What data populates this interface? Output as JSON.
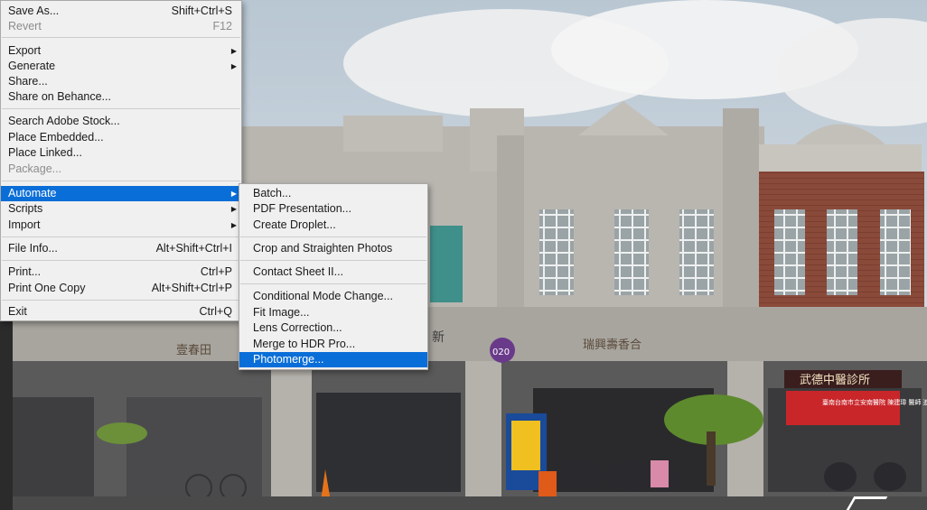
{
  "background": {
    "sign_1": "壹春田",
    "sign_2": "瑞興壽香合",
    "sign_3": "武德中醫診所",
    "banner": "臺南台南市立安南醫院 陳建瑋 醫師 進入轉診",
    "sign_4": "新",
    "sign_5": "020"
  },
  "file_menu": {
    "items": [
      {
        "label": "Save As...",
        "shortcut": "Shift+Ctrl+S"
      },
      {
        "label": "Revert",
        "shortcut": "F12"
      },
      {
        "label": "Export"
      },
      {
        "label": "Generate"
      },
      {
        "label": "Share..."
      },
      {
        "label": "Share on Behance..."
      },
      {
        "label": "Search Adobe Stock..."
      },
      {
        "label": "Place Embedded..."
      },
      {
        "label": "Place Linked..."
      },
      {
        "label": "Package..."
      },
      {
        "label": "Automate"
      },
      {
        "label": "Scripts"
      },
      {
        "label": "Import"
      },
      {
        "label": "File Info...",
        "shortcut": "Alt+Shift+Ctrl+I"
      },
      {
        "label": "Print...",
        "shortcut": "Ctrl+P"
      },
      {
        "label": "Print One Copy",
        "shortcut": "Alt+Shift+Ctrl+P"
      },
      {
        "label": "Exit",
        "shortcut": "Ctrl+Q"
      }
    ]
  },
  "automate_submenu": {
    "items": [
      {
        "label": "Batch..."
      },
      {
        "label": "PDF Presentation..."
      },
      {
        "label": "Create Droplet..."
      },
      {
        "label": "Crop and Straighten Photos"
      },
      {
        "label": "Contact Sheet II..."
      },
      {
        "label": "Conditional Mode Change..."
      },
      {
        "label": "Fit Image..."
      },
      {
        "label": "Lens Correction..."
      },
      {
        "label": "Merge to HDR Pro..."
      },
      {
        "label": "Photomerge..."
      }
    ]
  }
}
